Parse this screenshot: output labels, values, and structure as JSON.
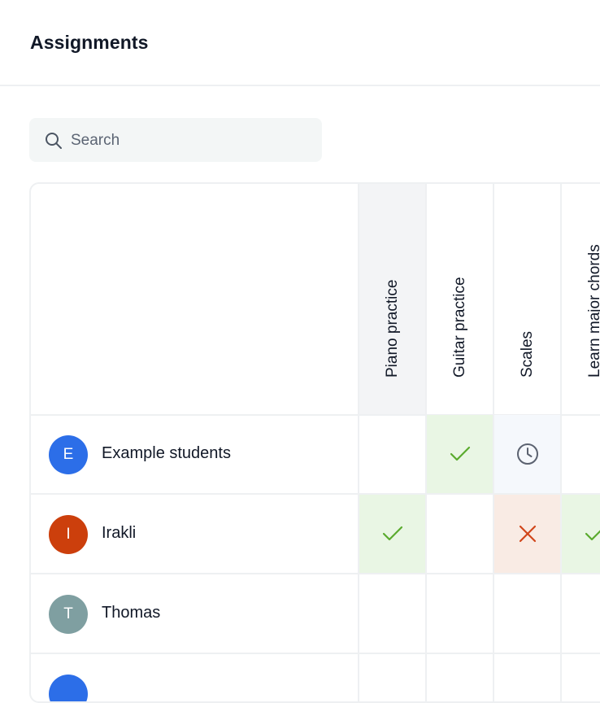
{
  "header": {
    "title": "Assignments"
  },
  "search": {
    "placeholder": "Search",
    "value": ""
  },
  "columns": [
    {
      "label": "Piano practice"
    },
    {
      "label": "Guitar practice"
    },
    {
      "label": "Scales"
    },
    {
      "label": "Learn major chords"
    }
  ],
  "students": [
    {
      "initial": "E",
      "name": "Example students",
      "avatar_color": "#2c6ee8",
      "statuses": [
        "none",
        "done",
        "pending",
        "none"
      ]
    },
    {
      "initial": "I",
      "name": "Irakli",
      "avatar_color": "#cc3f0c",
      "statuses": [
        "done",
        "none",
        "missed",
        "done"
      ]
    },
    {
      "initial": "T",
      "name": "Thomas",
      "avatar_color": "#7f9fa1",
      "statuses": [
        "none",
        "none",
        "none",
        "none"
      ]
    },
    {
      "initial": "",
      "name": "",
      "avatar_color": "#2c6ee8",
      "statuses": [
        "none",
        "none",
        "none",
        "none"
      ]
    }
  ],
  "colors": {
    "done_bg": "#e9f6e4",
    "done_icon": "#5aab2e",
    "missed_bg": "#f9ebe4",
    "missed_icon": "#d1461b",
    "pending_bg": "#f5f8fc",
    "pending_icon": "#5b6270",
    "border": "#eef0f2"
  },
  "icons": {
    "done": "check-icon",
    "missed": "cross-icon",
    "pending": "clock-icon",
    "search": "search-icon"
  }
}
